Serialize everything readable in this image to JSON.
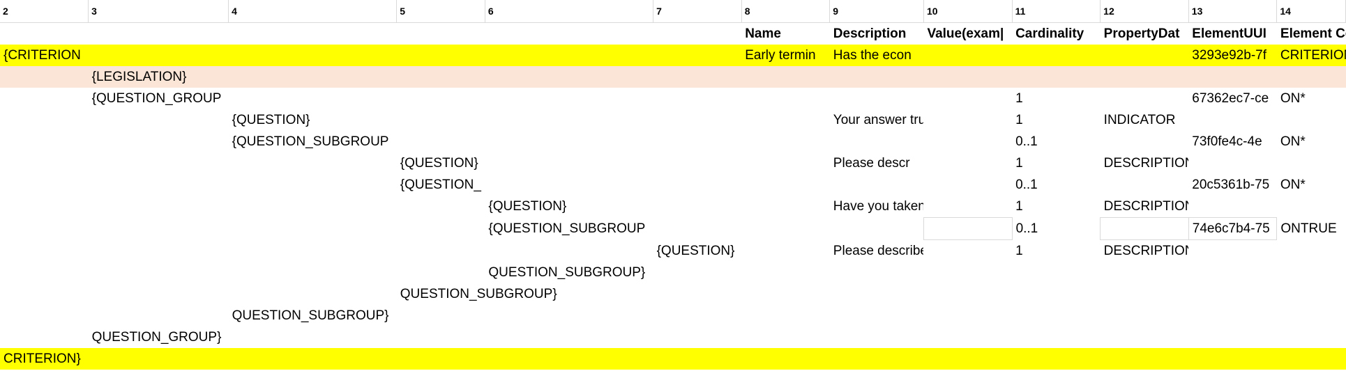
{
  "column_numbers": [
    "2",
    "3",
    "4",
    "5",
    "6",
    "7",
    "8",
    "9",
    "10",
    "11",
    "12",
    "13",
    "14"
  ],
  "headers": {
    "name": "Name",
    "description": "Description",
    "value": "Value(exam|",
    "cardinality": "Cardinality",
    "property": "PropertyDat",
    "uuid": "ElementUUI",
    "code": "Element Cod"
  },
  "colors": {
    "criterion_fill": "#ffff00",
    "legislation_fill": "#fbe5d6"
  },
  "rows": [
    {
      "depth_col": 0,
      "label": "{CRITERION",
      "name": "Early termin",
      "description": "Has the econ",
      "value": "",
      "cardinality": "",
      "property": "",
      "uuid": "3293e92b-7f",
      "code": "CRITERION.E"
    },
    {
      "depth_col": 1,
      "label": "{LEGISLATION}",
      "name": "",
      "description": "",
      "value": "",
      "cardinality": "",
      "property": "",
      "uuid": "",
      "code": ""
    },
    {
      "depth_col": 1,
      "label": "{QUESTION_GROUP",
      "name": "",
      "description": "",
      "value": "",
      "cardinality": "1",
      "property": "",
      "uuid": "67362ec7-ce",
      "code": "ON*"
    },
    {
      "depth_col": 2,
      "label": "{QUESTION}",
      "name": "",
      "description": "Your answer true",
      "value": "",
      "cardinality": "1",
      "property": "INDICATOR",
      "uuid": "",
      "code": ""
    },
    {
      "depth_col": 2,
      "label": "{QUESTION_SUBGROUP",
      "name": "",
      "description": "",
      "value": "",
      "cardinality": "0..1",
      "property": "",
      "uuid": "73f0fe4c-4e",
      "code": "ON*"
    },
    {
      "depth_col": 3,
      "label": "{QUESTION}",
      "name": "",
      "description": "Please descr",
      "value": "",
      "cardinality": "1",
      "property": "DESCRIPTION",
      "uuid": "",
      "code": ""
    },
    {
      "depth_col": 3,
      "label": "{QUESTION_",
      "name": "",
      "description": "",
      "value": "",
      "cardinality": "0..1",
      "property": "",
      "uuid": "20c5361b-75",
      "code": "ON*"
    },
    {
      "depth_col": 4,
      "label": "{QUESTION}",
      "name": "",
      "description": "Have you taken measures",
      "value": "",
      "cardinality": "1",
      "property": "DESCRIPTION",
      "uuid": "",
      "code": ""
    },
    {
      "depth_col": 4,
      "label": "{QUESTION_SUBGROUP",
      "name": "",
      "description": "",
      "value": "",
      "cardinality": "0..1",
      "property": "",
      "uuid": "74e6c7b4-75",
      "code": "ONTRUE"
    },
    {
      "depth_col": 5,
      "label": "{QUESTION}",
      "name": "",
      "description": "Please describe them",
      "value": "",
      "cardinality": "1",
      "property": "DESCRIPTION",
      "uuid": "",
      "code": ""
    },
    {
      "depth_col": 4,
      "label": "QUESTION_SUBGROUP}",
      "name": "",
      "description": "",
      "value": "",
      "cardinality": "",
      "property": "",
      "uuid": "",
      "code": ""
    },
    {
      "depth_col": 3,
      "label": "QUESTION_SUBGROUP}",
      "name": "",
      "description": "",
      "value": "",
      "cardinality": "",
      "property": "",
      "uuid": "",
      "code": ""
    },
    {
      "depth_col": 2,
      "label": "QUESTION_SUBGROUP}",
      "name": "",
      "description": "",
      "value": "",
      "cardinality": "",
      "property": "",
      "uuid": "",
      "code": ""
    },
    {
      "depth_col": 1,
      "label": "QUESTION_GROUP}",
      "name": "",
      "description": "",
      "value": "",
      "cardinality": "",
      "property": "",
      "uuid": "",
      "code": ""
    },
    {
      "depth_col": 0,
      "label": "CRITERION}",
      "name": "",
      "description": "",
      "value": "",
      "cardinality": "",
      "property": "",
      "uuid": "",
      "code": ""
    }
  ]
}
